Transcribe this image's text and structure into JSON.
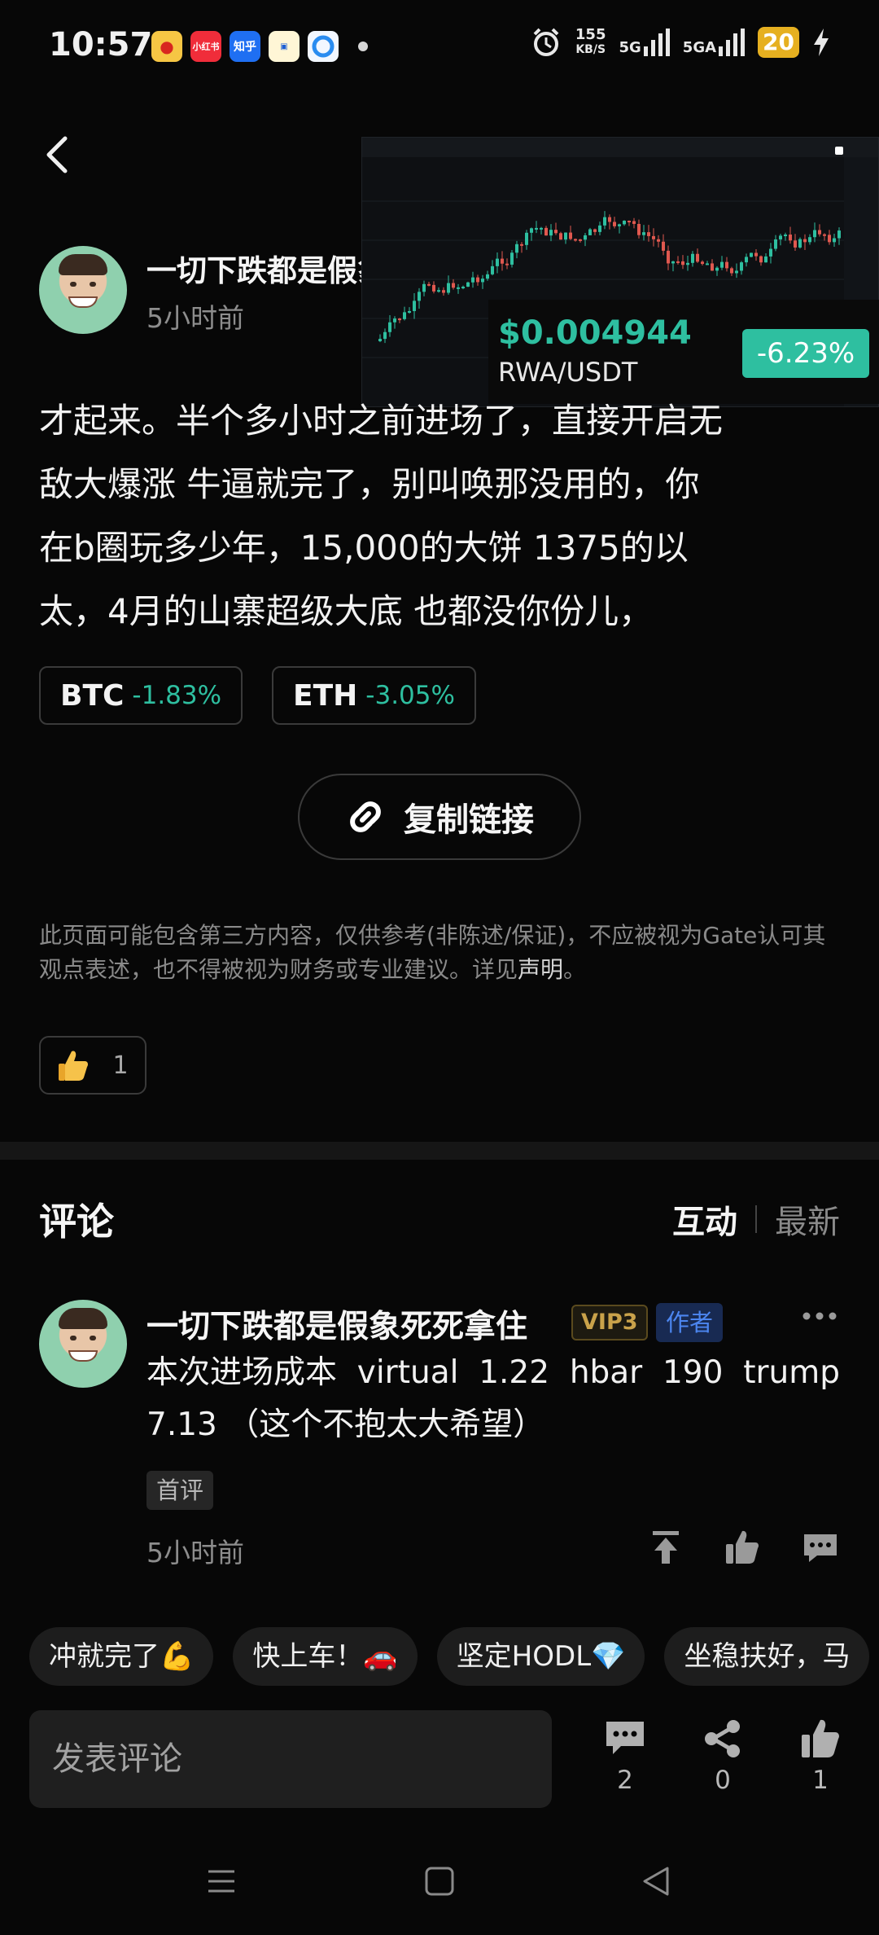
{
  "status_bar": {
    "time": "10:57",
    "app_icons": [
      "weibo-icon",
      "xiaohongshu-icon",
      "zhihu-icon",
      "bank-app-icon",
      "browser-icon"
    ],
    "xhs_label": "小红书",
    "zhihu_label": "知乎",
    "speed_value": "155",
    "speed_unit": "KB/S",
    "network_1": "5G",
    "network_2": "5GA",
    "battery": "20"
  },
  "post": {
    "author": "一切下跌都是假象死死拿住",
    "time": "5小时前",
    "body_lines": [
      "才起来。半个多小时之前进场了，直接开启无",
      "敌大爆涨  牛逼就完了，别叫唤那没用的，你",
      "在b圈玩多少年，15,000的大饼 1375的以",
      "太，4月的山寨超级大底 也都没你份儿，"
    ],
    "coins": [
      {
        "name": "BTC",
        "change": "-1.83%"
      },
      {
        "name": "ETH",
        "change": "-3.05%"
      }
    ],
    "copy_link_label": "复制链接",
    "disclaimer": "此页面可能包含第三方内容，仅供参考(非陈述/保证)，不应被视为Gate认可其观点表述，也不得被视为财务或专业建议。详见",
    "disclaimer_link": "声明",
    "disclaimer_end": "。",
    "likes": "1"
  },
  "price_overlay": {
    "price": "$0.004944",
    "pair": "RWA/USDT",
    "change": "-6.23%",
    "accent": "#2ebfa0"
  },
  "comments": {
    "title": "评论",
    "sort_tabs": [
      "互动",
      "最新"
    ],
    "items": [
      {
        "author": "一切下跌都是假象死死拿住",
        "vip": "VIP3",
        "author_badge": "作者",
        "line1": [
          "本次进场成本",
          "virtual",
          "1.22",
          "hbar",
          "190",
          "trump"
        ],
        "line2": "7.13 （这个不抱太大希望）",
        "tag": "首评",
        "time": "5小时前"
      }
    ]
  },
  "quick_replies": [
    "冲就完了💪",
    "快上车！🚗",
    "坚定HODL💎",
    "坐稳扶好，马"
  ],
  "bottom_bar": {
    "input_placeholder": "发表评论",
    "comment_count": "2",
    "share_count": "0",
    "like_count": "1"
  },
  "colors": {
    "background": "#070707",
    "positive_green": "#2ebfa0",
    "author_badge_blue": "#4c86f0",
    "vip_gold": "#c9a24a"
  }
}
